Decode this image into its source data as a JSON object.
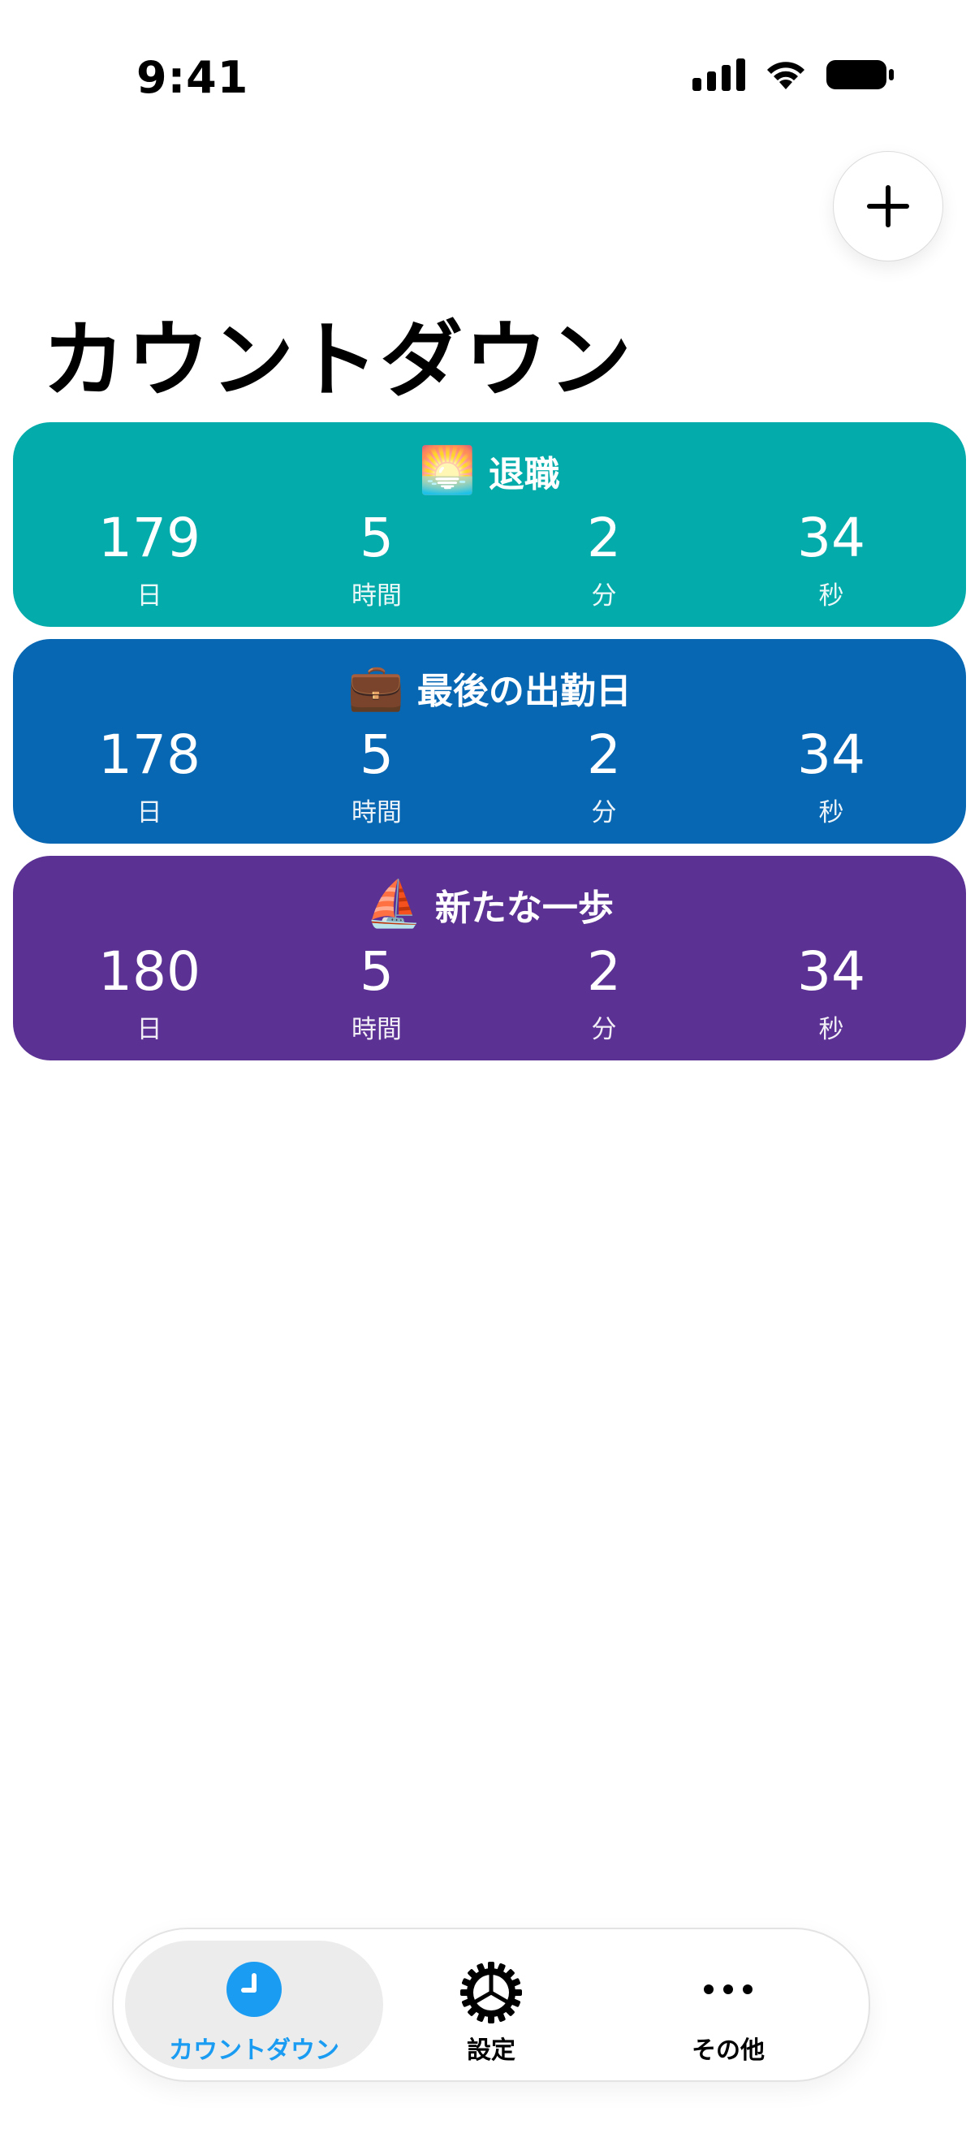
{
  "status_bar": {
    "time": "9:41"
  },
  "page": {
    "title": "カウントダウン"
  },
  "unit_labels": {
    "days": "日",
    "hours": "時間",
    "minutes": "分",
    "seconds": "秒"
  },
  "cards": [
    {
      "emoji": "🌅",
      "title": "退職",
      "color": "#03ABAA",
      "days": "179",
      "hours": "5",
      "minutes": "2",
      "seconds": "34"
    },
    {
      "emoji": "💼",
      "title": "最後の出勤日",
      "color": "#0767B3",
      "days": "178",
      "hours": "5",
      "minutes": "2",
      "seconds": "34"
    },
    {
      "emoji": "⛵",
      "title": "新たな一歩",
      "color": "#5B3193",
      "days": "180",
      "hours": "5",
      "minutes": "2",
      "seconds": "34"
    }
  ],
  "tabs": [
    {
      "label": "カウントダウン",
      "icon": "clock-icon",
      "active": true
    },
    {
      "label": "設定",
      "icon": "gear-icon",
      "active": false
    },
    {
      "label": "その他",
      "icon": "ellipsis-icon",
      "active": false
    }
  ],
  "colors": {
    "accent": "#1A9CF2"
  }
}
